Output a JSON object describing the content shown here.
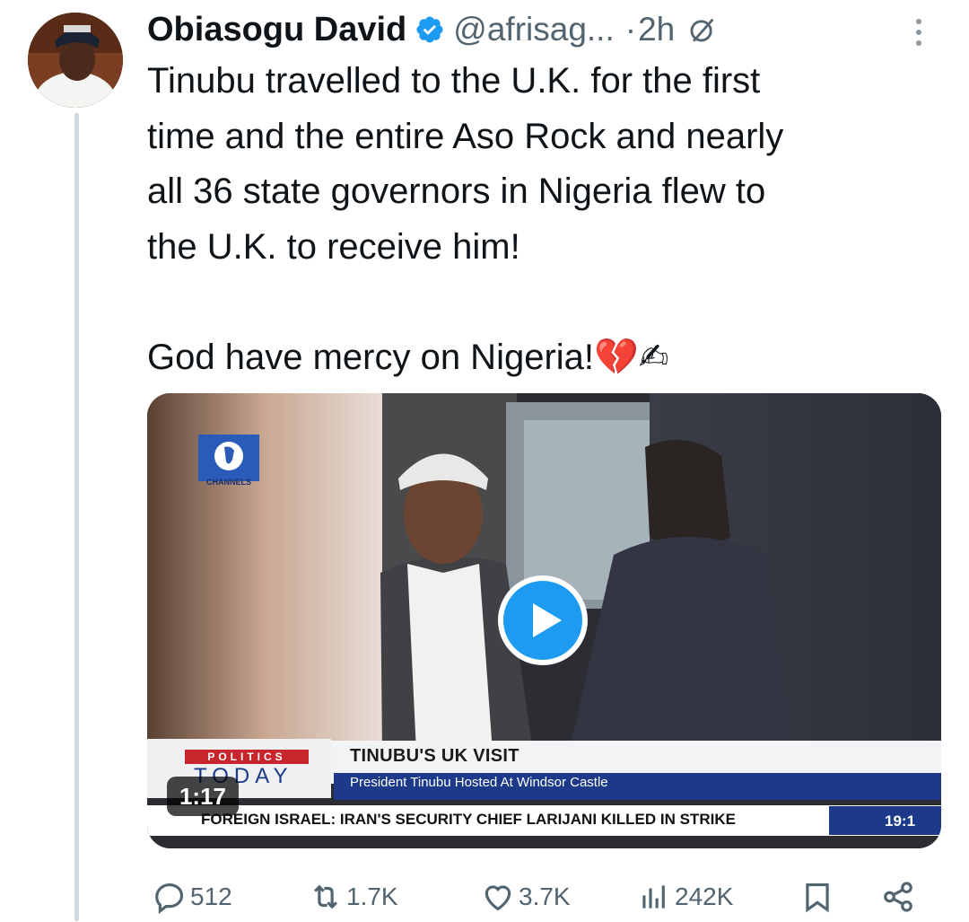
{
  "author": {
    "name": "Obiasogu David",
    "handle": "@afrisag...",
    "separator": "·",
    "time": "2h",
    "avatar_icon": "profile-photo",
    "verified_icon": "verified-badge-icon"
  },
  "tweet": {
    "text": "Tinubu travelled to the U.K. for the first\ntime and the entire Aso Rock and nearly\nall 36 state governors in Nigeria flew to\nthe U.K. to receive him!\n\nGod have mercy on Nigeria!💔✍"
  },
  "video": {
    "channel_logo_text": "CHANNELS",
    "program_top": "POLITICS",
    "program_bottom": "TODAY",
    "headline": "TINUBU'S UK VISIT",
    "subheadline": "President Tinubu Hosted At Windsor Castle",
    "ticker": "FOREIGN  ISRAEL: IRAN'S SECURITY CHIEF LARIJANI KILLED IN STRIKE",
    "clock": "19:1",
    "duration": "1:17"
  },
  "actions": {
    "replies": "512",
    "reposts": "1.7K",
    "likes": "3.7K",
    "views": "242K"
  },
  "colors": {
    "verified": "#1d9bf0",
    "secondary_text": "#536471",
    "thread_line": "#cfd9de",
    "play_button": "#1d9bf0"
  }
}
